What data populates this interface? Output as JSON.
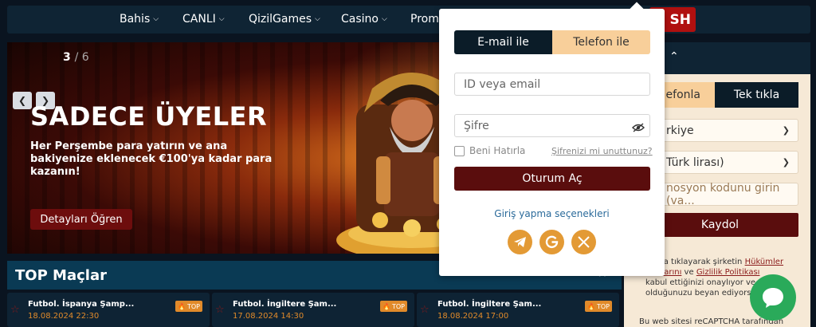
{
  "nav": {
    "items": [
      {
        "label": "Bahis"
      },
      {
        "label": "CANLI"
      },
      {
        "label": "QizilGames"
      },
      {
        "label": "Casino"
      },
      {
        "label": "Promo"
      }
    ],
    "badge": "SH"
  },
  "banner": {
    "pagination_current": "3",
    "pagination_total": "/ 6",
    "title": "SADECE ÜYELER",
    "subtitle": "Her Perşembe para yatırın ve ana bakiyenize eklenecek €100'ya kadar para kazanın!",
    "button": "Detayları Öğren"
  },
  "top_matches": {
    "title": "TOP Maçlar",
    "badge_label": "TOP",
    "matches": [
      {
        "name": "Futbol. İspanya Şamp...",
        "date": "18.08.2024 22:30"
      },
      {
        "name": "Futbol. İngiltere Şam...",
        "date": "17.08.2024 14:30"
      },
      {
        "name": "Futbol. İngiltere Şam...",
        "date": "18.08.2024 17:00"
      }
    ]
  },
  "login": {
    "tab_email": "E-mail ile",
    "tab_phone": "Telefon ile",
    "id_placeholder": "ID veya email",
    "password_placeholder": "Şifre",
    "remember": "Beni Hatırla",
    "forgot": "Şifrenizi mi unuttunuz?",
    "submit": "Oturum Aç",
    "options_label": "Giriş yapma seçenekleri",
    "social": [
      "telegram-icon",
      "google-icon",
      "x-icon"
    ],
    "accent": "#e39a35"
  },
  "register": {
    "tab_phone": "efonla",
    "tab_oneclick": "Tek tıkla",
    "country": "rkiye",
    "currency": "Türk lirası)",
    "promo_placeholder": "nosyon kodunu girin (va...",
    "submit": "Kaydol",
    "terms_part1": "utona tıklayarak şirketin",
    "terms_link1": "Hükümler",
    "terms_link1b": "oşullarını",
    "terms_and": "ve",
    "terms_link2": "Gizlilik Politikası",
    "terms_part2": "kabul ettiğinizi onaylıyor ve",
    "terms_part3": "olduğunuzu beyan ediyors",
    "recaptcha": "Bu web sitesi reCAPTCHA tarafından"
  },
  "colors": {
    "brand_red": "#5a0d0d",
    "nav_bg": "#0f2434",
    "tab_active": "#0b1c28",
    "tab_inactive": "#f8cf9a"
  }
}
